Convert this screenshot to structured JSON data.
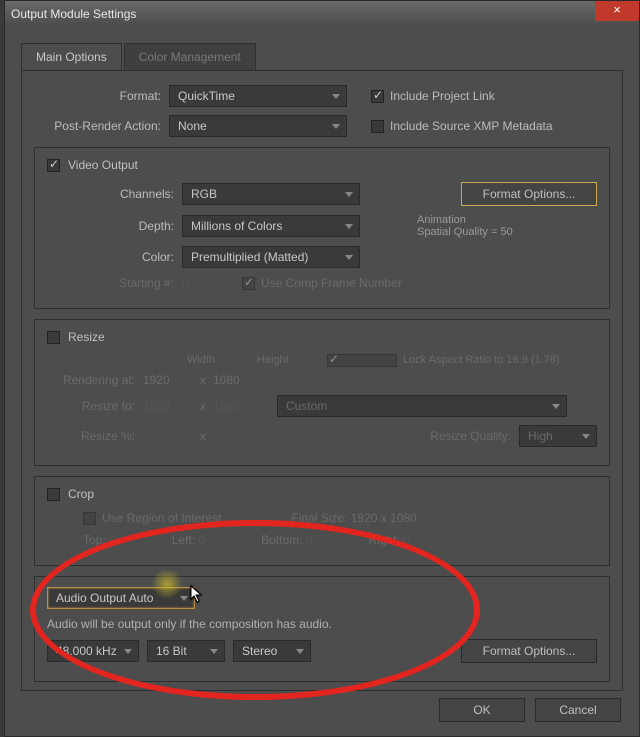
{
  "window": {
    "title": "Output Module Settings"
  },
  "tabs": {
    "main": "Main Options",
    "color": "Color Management"
  },
  "format": {
    "label": "Format:",
    "value": "QuickTime",
    "post_label": "Post-Render Action:",
    "post_value": "None",
    "include_link": "Include Project Link",
    "include_xmp": "Include Source XMP Metadata"
  },
  "video": {
    "header": "Video Output",
    "channels_label": "Channels:",
    "channels_value": "RGB",
    "depth_label": "Depth:",
    "depth_value": "Millions of Colors",
    "color_label": "Color:",
    "color_value": "Premultiplied (Matted)",
    "starting_label": "Starting #:",
    "starting_value": "0",
    "use_comp": "Use Comp Frame Number",
    "format_options": "Format Options...",
    "codec": "Animation",
    "quality": "Spatial Quality = 50"
  },
  "resize": {
    "header": "Resize",
    "width": "Width",
    "height": "Height",
    "lock": "Lock Aspect Ratio to 16:9 (1.78)",
    "rendering_label": "Rendering at:",
    "rw": "1920",
    "rh": "1080",
    "resize_label": "Resize to:",
    "tw": "1920",
    "th": "1080",
    "preset": "Custom",
    "pct_label": "Resize %:",
    "quality_label": "Resize Quality:",
    "quality_value": "High",
    "x": "x"
  },
  "crop": {
    "header": "Crop",
    "roi": "Use Region of Interest",
    "final": "Final Size: 1920 x 1080",
    "top": "Top:",
    "left": "Left:",
    "bottom": "Bottom:",
    "right": "Right:",
    "zero": "0"
  },
  "audio": {
    "mode": "Audio Output Auto",
    "hint": "Audio will be output only if the composition has audio.",
    "rate": "48.000 kHz",
    "bit": "16 Bit",
    "channels": "Stereo",
    "format_options": "Format Options..."
  },
  "buttons": {
    "ok": "OK",
    "cancel": "Cancel"
  }
}
